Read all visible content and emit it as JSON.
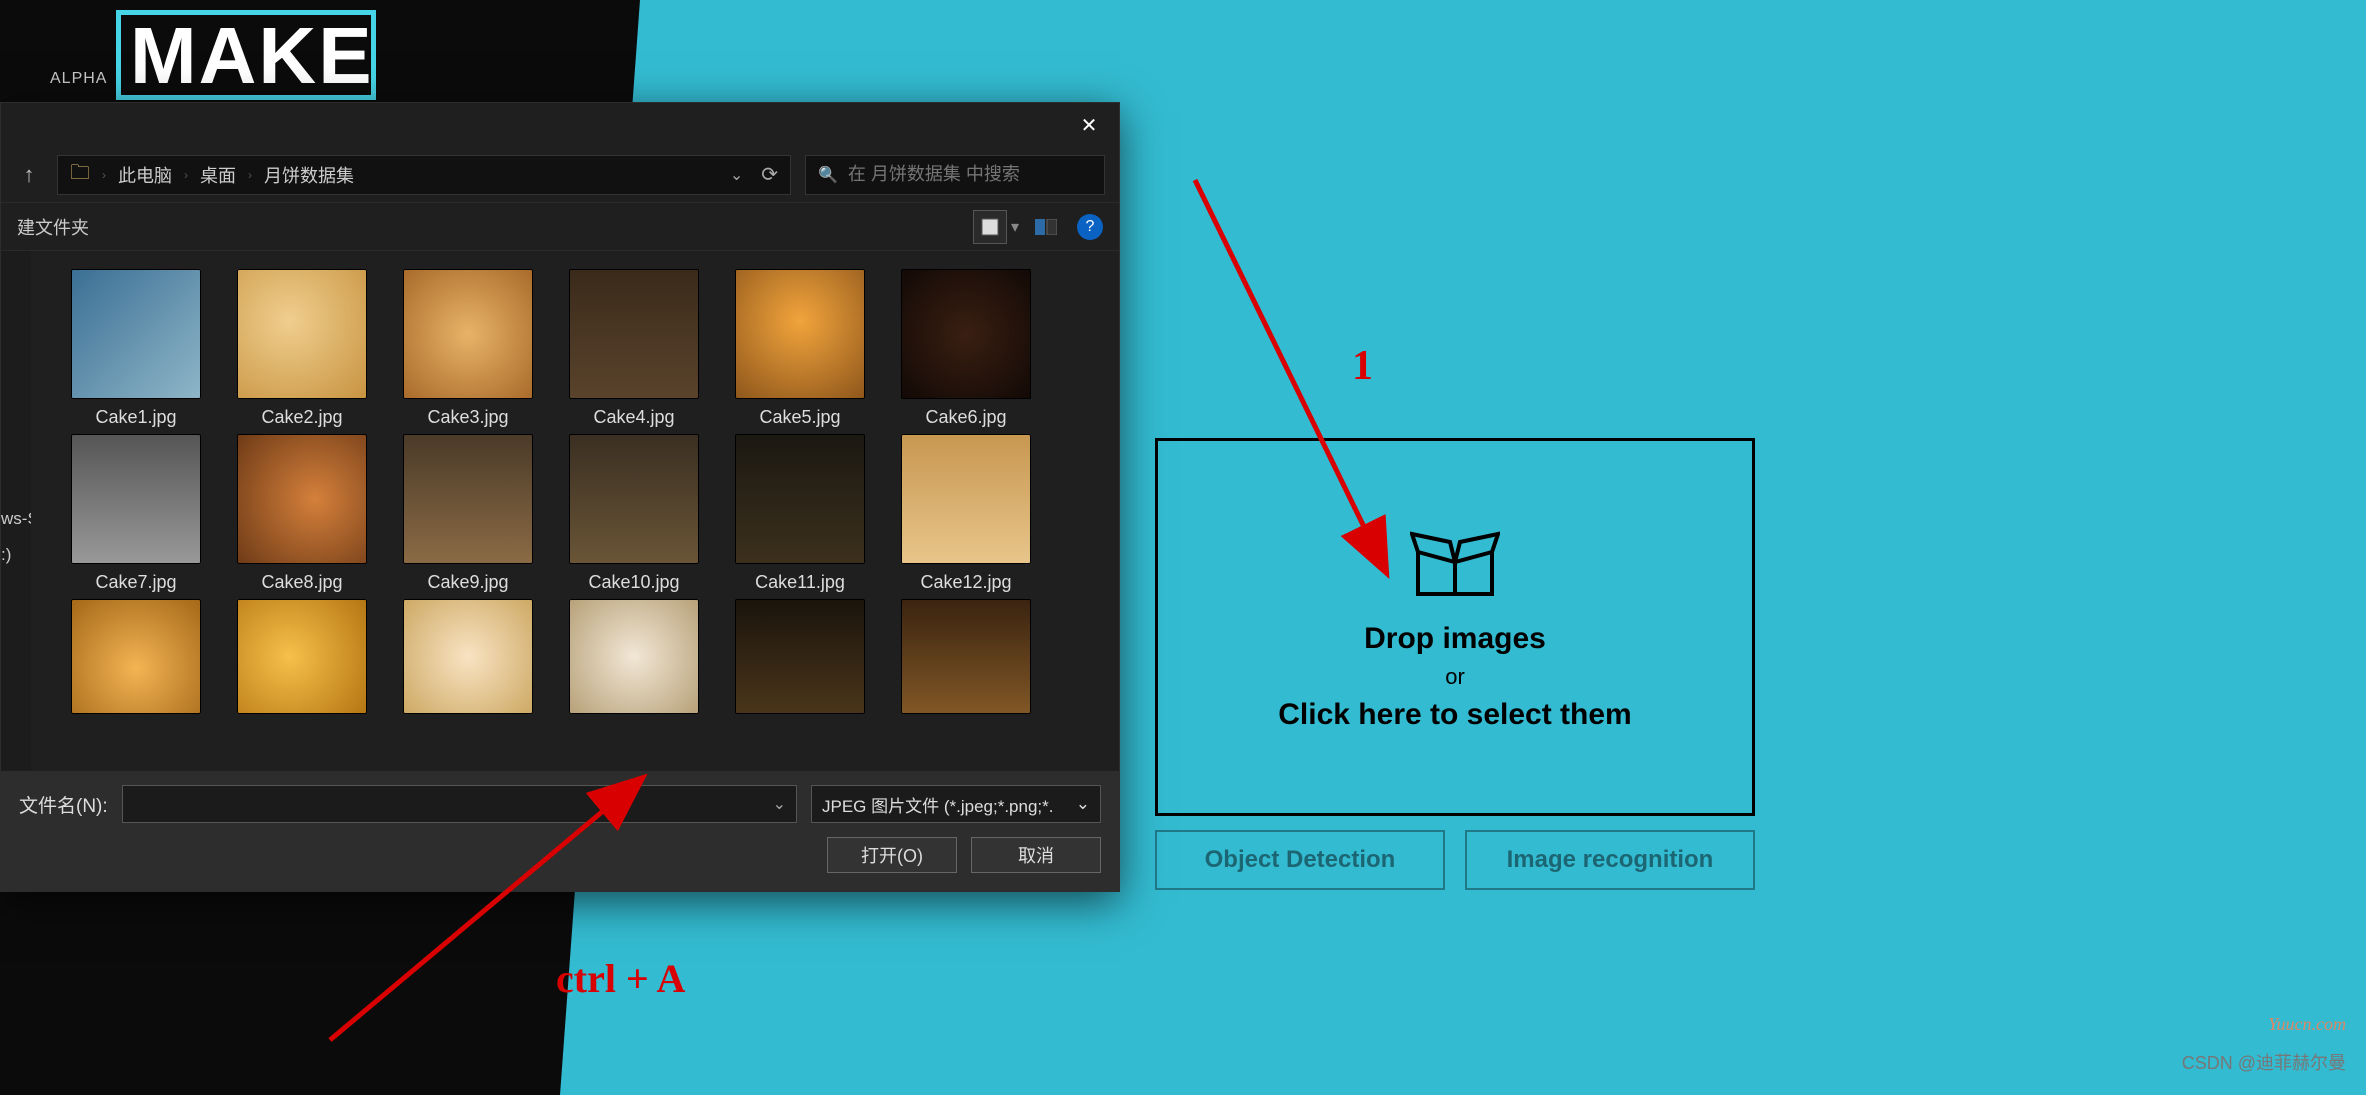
{
  "branding": {
    "make": "MAKE",
    "alpha": "ALPHA"
  },
  "dialog": {
    "breadcrumb": {
      "root": "此电脑",
      "mid": "桌面",
      "leaf": "月饼数据集"
    },
    "search_placeholder": "在 月饼数据集 中搜索",
    "new_folder": "建文件夹",
    "sidebar": {
      "item1": "ws-SSD",
      "item2": ":)"
    },
    "files": [
      "Cake1.jpg",
      "Cake2.jpg",
      "Cake3.jpg",
      "Cake4.jpg",
      "Cake5.jpg",
      "Cake6.jpg",
      "Cake7.jpg",
      "Cake8.jpg",
      "Cake9.jpg",
      "Cake10.jpg",
      "Cake11.jpg",
      "Cake12.jpg"
    ],
    "filename_label": "文件名(N):",
    "filetype": "JPEG 图片文件 (*.jpeg;*.png;*.",
    "open": "打开(O)",
    "cancel": "取消"
  },
  "dropzone": {
    "title": "Drop images",
    "or": "or",
    "subtitle": "Click here to select them"
  },
  "buttons": {
    "detect": "Object Detection",
    "recog": "Image recognition"
  },
  "annotations": {
    "one": "1",
    "hint": "ctrl + A"
  },
  "watermarks": {
    "w1": "Yuucn.com",
    "w2": "CSDN @迪菲赫尔曼"
  }
}
